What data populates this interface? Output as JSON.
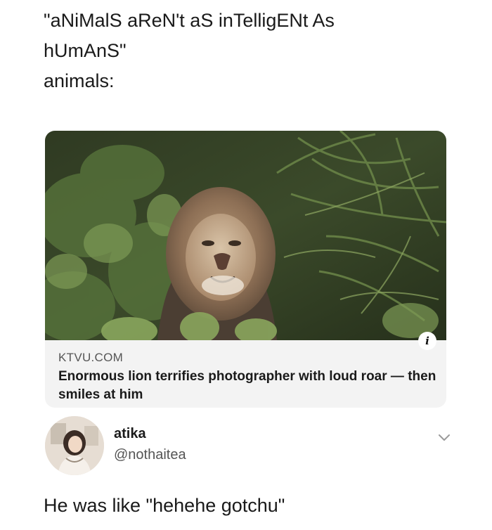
{
  "tweet": {
    "lines": [
      "\"aNiMalS aReN't aS inTelligENt As",
      "hUmAnS\"",
      "animals:"
    ]
  },
  "card": {
    "domain": "KTVU.COM",
    "title": "Enormous lion terrifies photographer with loud roar — then smiles at him",
    "image_subject": "lion-photo",
    "info_icon": "info-icon"
  },
  "reply": {
    "name": "atika",
    "handle": "@nothaitea",
    "text": "He was like \"hehehe gotchu\"",
    "menu_icon": "chevron-down-icon"
  }
}
